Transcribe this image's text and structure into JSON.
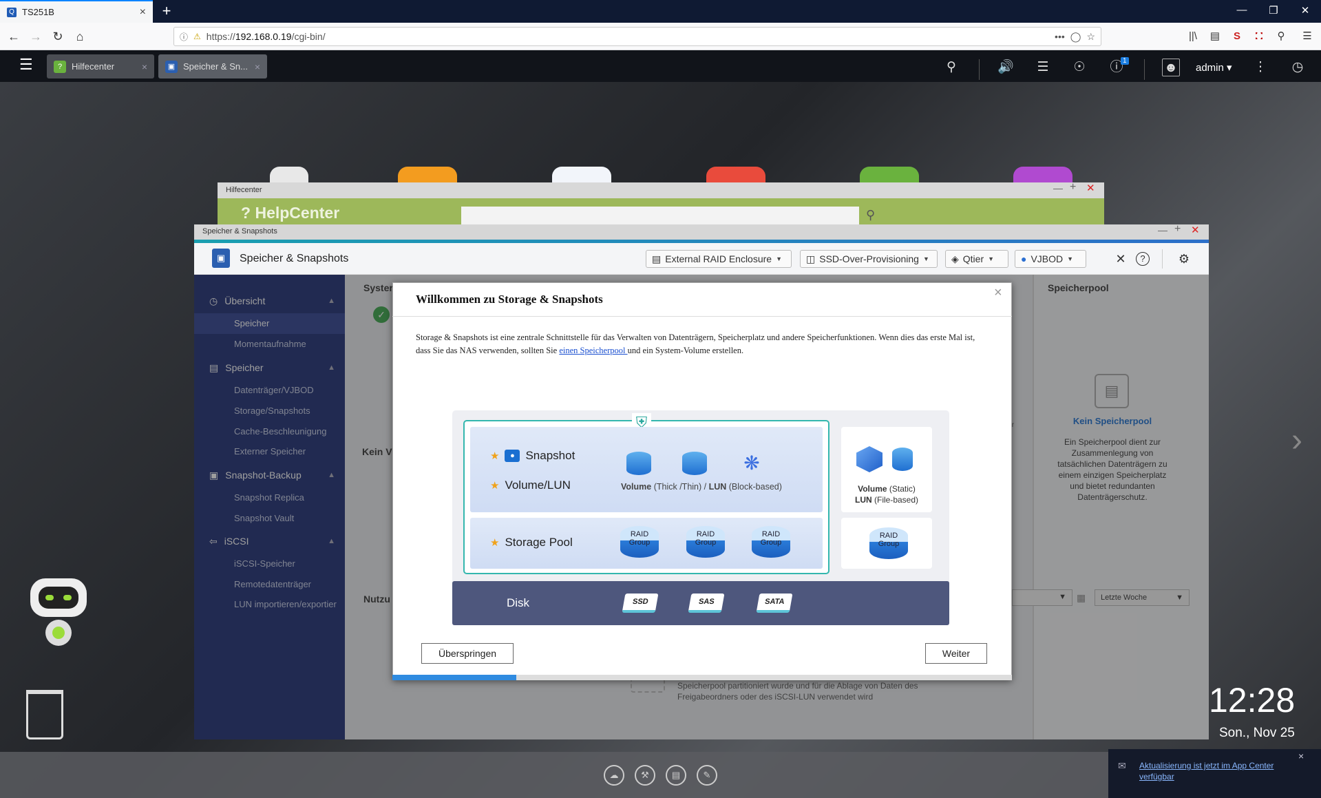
{
  "browser": {
    "tab_title": "TS251B",
    "tab_close": "×",
    "new_tab": "+",
    "url_prefix": "https://",
    "url_host": "192.168.0.19",
    "url_path": "/cgi-bin/",
    "url_more": "•••"
  },
  "qts": {
    "tabs": [
      {
        "label": "Hilfecenter",
        "close": "×"
      },
      {
        "label": "Speicher & Sn...",
        "close": "×"
      }
    ],
    "notification_count": "1",
    "user": "admin"
  },
  "helpcenter": {
    "window_title": "Hilfecenter",
    "logo_text": "HelpCenter"
  },
  "storage": {
    "window_title": "Speicher & Snapshots",
    "app_title": "Speicher & Snapshots",
    "header_buttons": [
      "External RAID Enclosure",
      "SSD-Over-Provisioning",
      "Qtier",
      "VJBOD"
    ],
    "sidebar": {
      "sections": [
        {
          "label": "Übersicht",
          "items": [
            "Speicher",
            "Momentaufnahme"
          ]
        },
        {
          "label": "Speicher",
          "items": [
            "Datenträger/VJBOD",
            "Storage/Snapshots",
            "Cache-Beschleunigung",
            "Externer Speicher"
          ]
        },
        {
          "label": "Snapshot-Backup",
          "items": [
            "Snapshot Replica",
            "Snapshot Vault"
          ]
        },
        {
          "label": "iSCSI",
          "items": [
            "iSCSI-Speicher",
            "Remotedatenträger",
            "LUN importieren/exportier"
          ]
        }
      ]
    },
    "content": {
      "system_label": "Syster",
      "kein_label": "Kein V",
      "nutz_label": "Nutzu",
      "right_title": "Speicherpool",
      "no_pool_title": "Kein Speicherpool",
      "no_pool_desc": "Ein Speicherpool dient zur Zusammenlegung von tatsächlichen Datenträgern zu einem einzigen Speicherplatz und bietet redundanten Datenträgerschutz.",
      "period_select": "Letzte Woche",
      "below_text": "Speicherpool partitioniert wurde und für die Ablage von Daten des Freigabeordners oder des iSCSI-LUN verwendet wird",
      "ier_text": "ier"
    }
  },
  "modal": {
    "title": "Willkommen zu Storage & Snapshots",
    "close": "×",
    "desc_before": "Storage & Snapshots ist eine zentrale Schnittstelle für das Verwalten von Datenträgern, Speicherplatz und andere Speicherfunktionen. Wenn dies das erste Mal ist, dass Sie das NAS verwenden, sollten Sie ",
    "desc_link": "einen Speicherpool ",
    "desc_after": "und ein System-Volume erstellen.",
    "diagram": {
      "snapshot": "Snapshot",
      "volume_lun": "Volume/LUN",
      "storage_pool": "Storage Pool",
      "disk": "Disk",
      "volume_bold": "Volume",
      "volume_note": " (Thick /Thin)",
      "lun_sep": " / ",
      "lun_bold": "LUN",
      "lun_note": " (Block-based)",
      "static_volume": "Volume",
      "static_note": " (Static)",
      "file_lun": "LUN",
      "file_note": " (File-based)",
      "raid_label": "RAID Group",
      "disks": [
        "SSD",
        "SAS",
        "SATA"
      ]
    },
    "skip_button": "Überspringen",
    "next_button": "Weiter",
    "progress": 0.2
  },
  "clock": {
    "time": "12:28",
    "date": "Son., Nov 25"
  },
  "notification": {
    "text": "Aktualisierung ist jetzt im App Center verfügbar",
    "close": "×"
  }
}
